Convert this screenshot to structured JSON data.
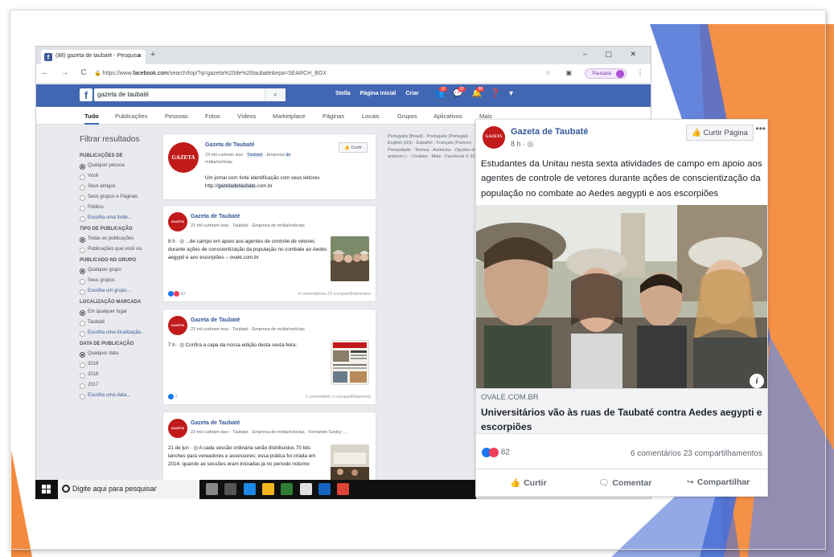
{
  "colors": {
    "facebook_blue": "#4267b2",
    "link_blue": "#365899",
    "slide_orange": "#f48a3d",
    "slide_blue": "#4a6fd6"
  },
  "browser": {
    "tab_title": "(88) gazeta de taubaté - Pesquisa",
    "tab_close": "×",
    "new_tab": "+",
    "window_controls": "–  ▢  ✕",
    "nav_buttons": "← → C",
    "url_prefix": "https://www.",
    "url_host": "facebook.com",
    "url_rest": "/search/top/?q=gazeta%20de%20taubaté&epa=SEARCH_BOX",
    "profile_label": "Pausada"
  },
  "facebook": {
    "search_value": "gazeta de taubaté",
    "nav": [
      "Stella",
      "Página inicial",
      "Criar"
    ],
    "badges": [
      "18",
      "20",
      "88"
    ],
    "filter_tabs": [
      "Tudo",
      "Publicações",
      "Pessoas",
      "Fotos",
      "Vídeos",
      "Marketplace",
      "Páginas",
      "Locais",
      "Grupos",
      "Aplicativos",
      "Mais"
    ],
    "left": {
      "title": "Filtrar resultados",
      "sections": [
        {
          "heading": "PUBLICAÇÕES DE",
          "options": [
            "Qualquer pessoa",
            "Você",
            "Seus amigos",
            "Seus grupos e Páginas",
            "Público",
            "Escolha uma fonte..."
          ]
        },
        {
          "heading": "TIPO DE PUBLICAÇÃO",
          "options": [
            "Todas as publicações",
            "Publicações que você viu"
          ]
        },
        {
          "heading": "PUBLICADO NO GRUPO",
          "options": [
            "Qualquer grupo",
            "Seus grupos",
            "Escolha um grupo..."
          ]
        },
        {
          "heading": "LOCALIZAÇÃO MARCADA",
          "options": [
            "Em qualquer lugar",
            "Taubaté",
            "Escolha uma localização..."
          ]
        },
        {
          "heading": "DATA DE PUBLICAÇÃO",
          "options": [
            "Qualquer data",
            "2019",
            "2018",
            "2017",
            "Escolha uma data..."
          ]
        }
      ]
    },
    "page_card": {
      "logo_text": "GAZETA",
      "name": "Gazeta de Taubaté",
      "meta_a": "23 mil curtiram isso · ",
      "meta_hl1": "Taubaté",
      "meta_b": " · Empresa ",
      "meta_hl2": "de",
      "meta_c": "mídia/notícias",
      "desc": "Um jornal com forte identificação com seus leitores",
      "link_pre": "http://",
      "link_hl": "gazetadetaubate",
      "link_post": ".com.br",
      "like_btn": "👍 Curtir"
    },
    "posts": [
      {
        "avatar": "GAZETA",
        "name": "Gazeta de Taubaté",
        "meta": "23 mil curtiram isso · Taubaté · Empresa de mídia/notícias",
        "text": "8 h · ◎   ...de campo em apoio aos agentes de controle de vetores durante ações de conscientização da população no combate ao Aedes aegypti e aos escorpiões – ovale.com.br",
        "reactions": "82",
        "counts": "6 comentários  23 compartilhamentos"
      },
      {
        "avatar": "GAZETA",
        "name": "Gazeta de Taubaté",
        "meta": "23 mil curtiram isso · Taubaté · Empresa de mídia/notícias",
        "text": "7 h · ◎   Confira a capa da nossa edição desta sexta-feira:",
        "reactions": "7",
        "counts": "1 comentário  1 compartilhamento"
      },
      {
        "avatar": "GAZETA",
        "name": "Gazeta de Taubaté",
        "meta": "23 mil curtiram isso · Taubaté · Empresa de mídia/notícias · Fernando Godoy ...",
        "text": "21 de jun · ◎  A cada sessão ordinária serão distribuídos 70 kits lanches para vereadores e assessores; essa prática foi criada em 2014, quando as sessões eram iniciadas já no período noturno",
        "reactions": "",
        "counts": ""
      }
    ],
    "right_col": "Português (Brasil) · Português (Portugal) · English (US) · Español · Français (France) Privacidade · Termos · Anúncios · Opções de anúncio ▷ · Cookies · Mais · Facebook © 2019"
  },
  "taskbar": {
    "search_placeholder": "Digite aqui para pesquisar"
  },
  "popup": {
    "avatar": "GAZETA",
    "name": "Gazeta de Taubaté",
    "meta": "8 h · ◎",
    "like_page": "👍 Curtir Página",
    "more": "•••",
    "text": "Estudantes da Unitau nesta sexta atividades de campo em apoio aos agentes de controle de vetores durante ações de conscientização da população no combate ao Aedes aegypti e aos escorpiões",
    "info": "i",
    "domain": "OVALE.COM.BR",
    "link_title": "Universitários vão às ruas de Taubaté contra Aedes aegypti e escorpiões",
    "reactions": "82",
    "counts": "6 comentários  23 compartilhamentos",
    "actions": [
      "Curtir",
      "Comentar",
      "Compartilhar"
    ]
  }
}
